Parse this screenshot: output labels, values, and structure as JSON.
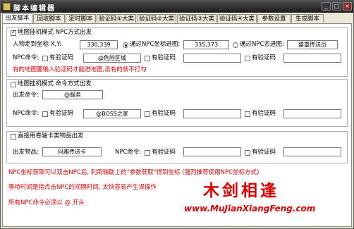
{
  "window": {
    "title": "脚本编辑器",
    "min": "_",
    "max": "□",
    "close": "×"
  },
  "tabs": [
    "出发脚本",
    "回收脚本",
    "定时脚本",
    "验证码①大类",
    "验证码②大类",
    "验证码③大类",
    "验证码④大类",
    "参数设置",
    "生成脚本"
  ],
  "g1": {
    "title": "地图挂机模式  NPC方式出发",
    "coord_label": "人物走到坐标 X,Y:",
    "coord_value": "330,339",
    "radio1_label": "通过NPC坐标进图:",
    "radio1_value": "335,373",
    "radio2_label": "通过NPC名进图:",
    "radio2_value": "盟重传送员",
    "npc_label": "NPC命令:",
    "has_captcha": "有验证码",
    "cmd1": "@危险区域",
    "cmd2": "",
    "cmd3": "",
    "note": "有的地图要输入验证码才能进地图,没有的就不打勾"
  },
  "g2": {
    "title": "地图挂机模式  命令方式出发",
    "depart_label": "出发命令:",
    "depart_value": "@服务",
    "npc_label": "NPC命令:",
    "has_captcha": "有验证码",
    "cmd1": "@BOSS之家",
    "cmd2": "",
    "cmd3": ""
  },
  "g3": {
    "title": "直接用卷轴卡类物品出发",
    "item_label": "出发物品:",
    "item_value": "玛雅传送卡",
    "npc_label": "NPC命令:",
    "has_captcha": "有验证码",
    "cmd1": "",
    "cmd2": ""
  },
  "notes": [
    "NPC坐标获取可以双击NPC后, 利用辅助上的\"参数获取\"得到坐标 (强烈推荐使用NPC坐标方式)",
    "等待时间是指点击NPC的间隔时间, 太快容易产生误操作",
    "所有NPC命令必须以 @ 开头"
  ],
  "watermark": {
    "text": "木剑相逢",
    "url": "www.MuJianXiangFeng.com"
  },
  "colors": {
    "accent": "#e00000",
    "titlebar": "#1c1c1c"
  }
}
